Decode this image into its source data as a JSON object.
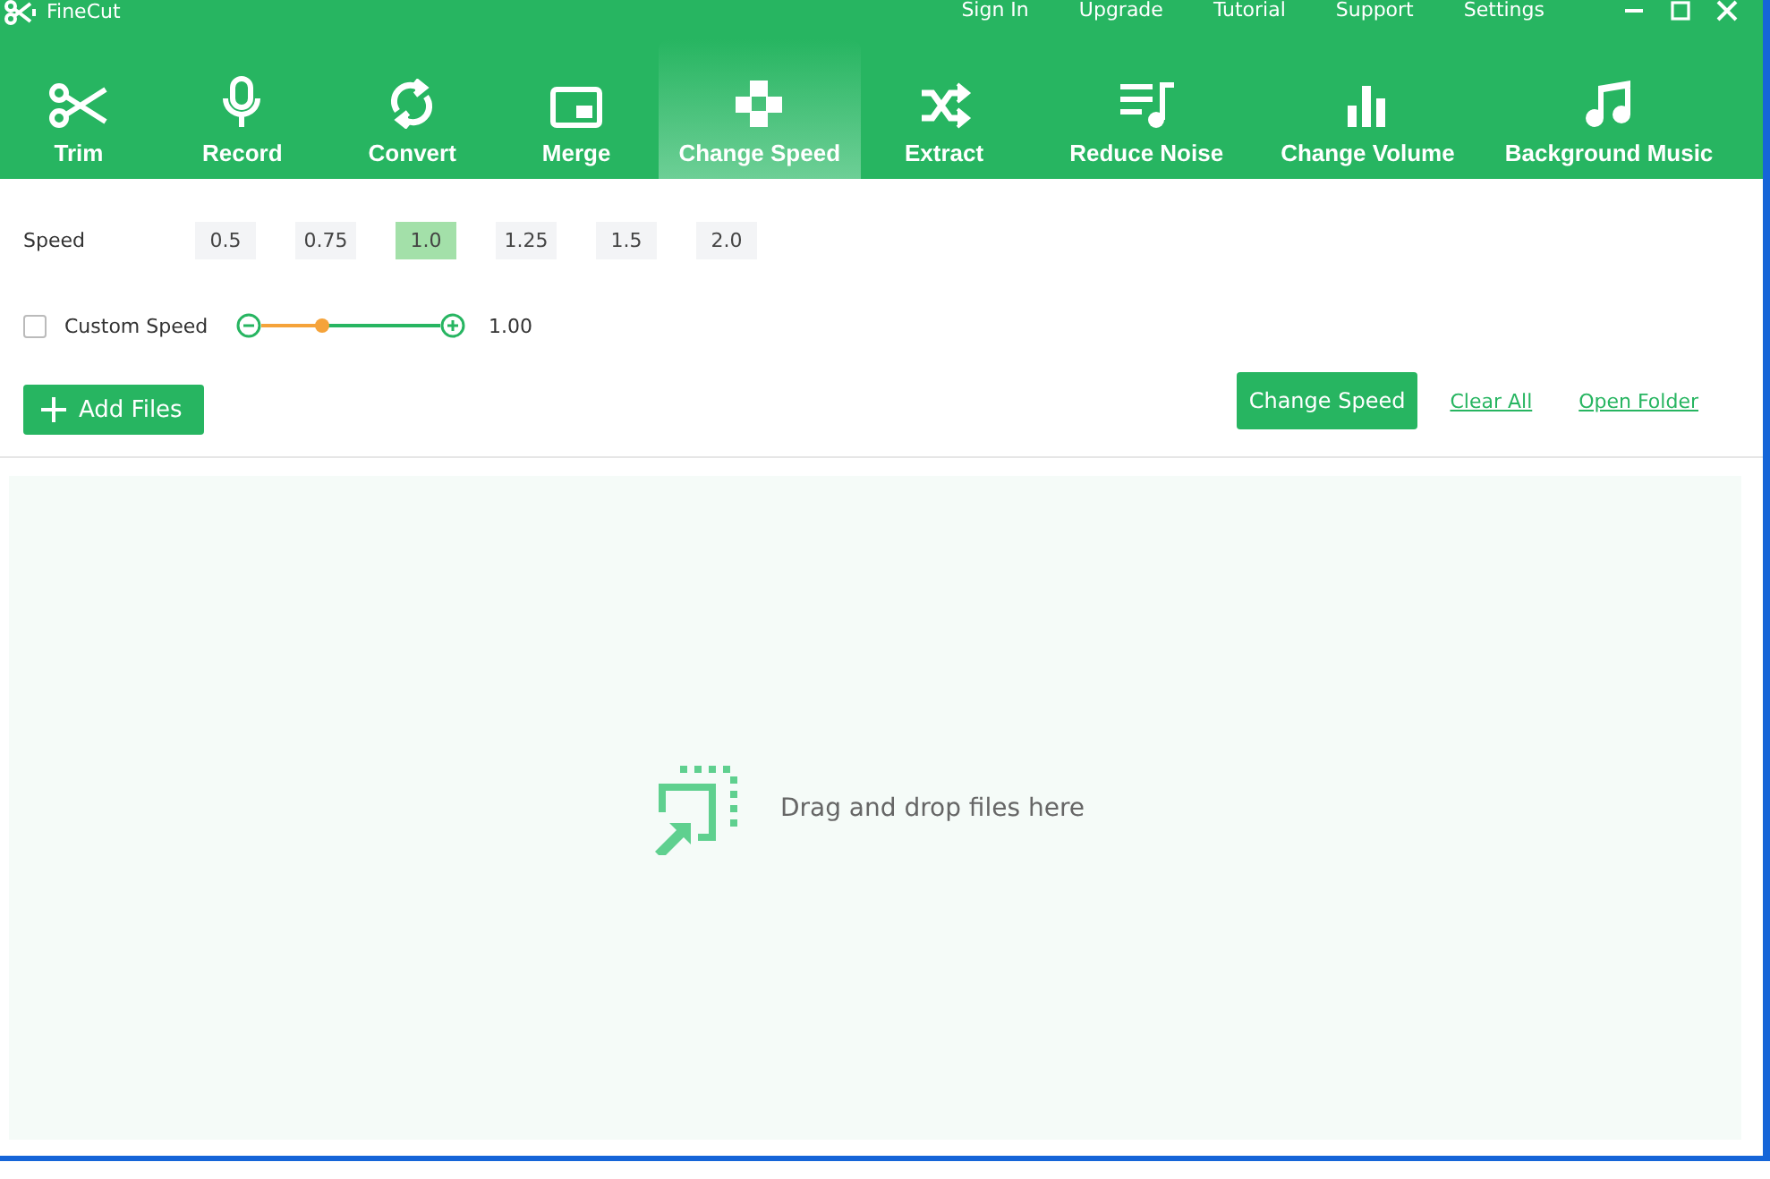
{
  "window": {
    "title": "FineCut"
  },
  "top_links": [
    "Sign In",
    "Upgrade",
    "Tutorial",
    "Support",
    "Settings"
  ],
  "toolbar": [
    {
      "label": "Trim",
      "selected": false
    },
    {
      "label": "Record",
      "selected": false
    },
    {
      "label": "Convert",
      "selected": false
    },
    {
      "label": "Merge",
      "selected": false
    },
    {
      "label": "Change Speed",
      "selected": true
    },
    {
      "label": "Extract",
      "selected": false
    },
    {
      "label": "Reduce Noise",
      "selected": false
    },
    {
      "label": "Change Volume",
      "selected": false
    },
    {
      "label": "Background Music",
      "selected": false
    }
  ],
  "speed": {
    "label": "Speed",
    "options": [
      {
        "label": "0.5",
        "selected": false
      },
      {
        "label": "0.75",
        "selected": false
      },
      {
        "label": "1.0",
        "selected": true
      },
      {
        "label": "1.25",
        "selected": false
      },
      {
        "label": "1.5",
        "selected": false
      },
      {
        "label": "2.0",
        "selected": false
      }
    ]
  },
  "custom_speed": {
    "label": "Custom Speed",
    "checked": false,
    "level": 0.34,
    "reading": "1.00"
  },
  "add_files": "Add Files",
  "change_speed_button": "Change Speed",
  "links": [
    "Clear All",
    "Open Folder"
  ],
  "drop_zone": {
    "text": "Drag and drop files here"
  }
}
